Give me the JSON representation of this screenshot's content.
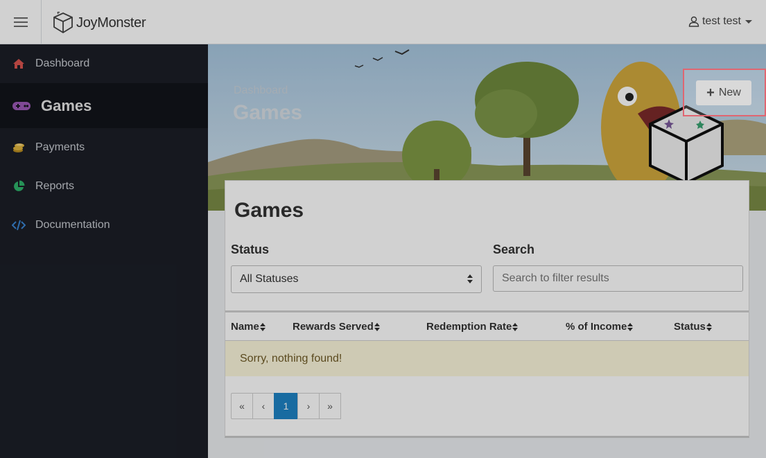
{
  "header": {
    "brand": "JoyMonster",
    "user_name": "test test"
  },
  "sidebar": {
    "items": [
      {
        "label": "Dashboard",
        "icon": "home-icon",
        "color": "#d9534f"
      },
      {
        "label": "Games",
        "icon": "gamepad-icon",
        "color": "#9b59b6",
        "active": true
      },
      {
        "label": "Payments",
        "icon": "coins-icon",
        "color": "#e0b43c"
      },
      {
        "label": "Reports",
        "icon": "pie-chart-icon",
        "color": "#2fb36b"
      },
      {
        "label": "Documentation",
        "icon": "code-icon",
        "color": "#3a86d4"
      }
    ]
  },
  "hero": {
    "breadcrumb": "Dashboard",
    "title": "Games",
    "new_button_label": "New"
  },
  "card": {
    "title": "Games",
    "status_label": "Status",
    "status_value": "All Statuses",
    "search_label": "Search",
    "search_placeholder": "Search to filter results"
  },
  "table": {
    "columns": [
      "Name",
      "Rewards Served",
      "Redemption Rate",
      "% of Income",
      "Status"
    ],
    "empty_message": "Sorry, nothing found!"
  },
  "pagination": {
    "first": "«",
    "prev": "‹",
    "current": "1",
    "next": "›",
    "last": "»",
    "active_color": "#1e83c5"
  }
}
